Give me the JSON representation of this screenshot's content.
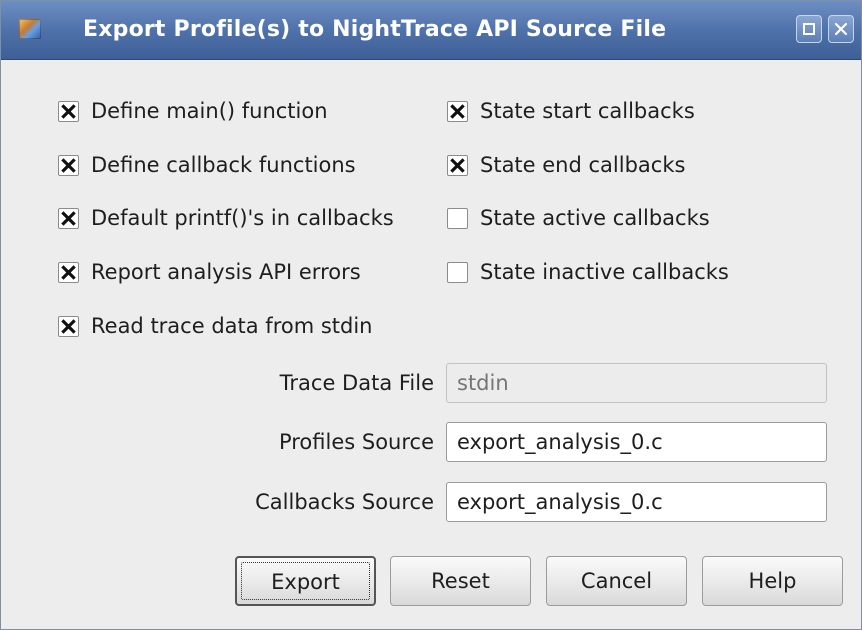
{
  "window": {
    "title": "Export Profile(s) to NightTrace API Source File",
    "icon": "nighttrace-app-icon",
    "controls": [
      "maximize-icon",
      "close-icon"
    ]
  },
  "options": {
    "left": [
      {
        "label": "Define main() function",
        "checked": true
      },
      {
        "label": "Define callback functions",
        "checked": true
      },
      {
        "label": "Default printf()'s in callbacks",
        "checked": true
      },
      {
        "label": "Report analysis API errors",
        "checked": true
      },
      {
        "label": "Read trace data from stdin",
        "checked": true
      }
    ],
    "right": [
      {
        "label": "State start callbacks",
        "checked": true
      },
      {
        "label": "State end callbacks",
        "checked": true
      },
      {
        "label": "State active callbacks",
        "checked": false
      },
      {
        "label": "State inactive callbacks",
        "checked": false
      }
    ]
  },
  "fields": {
    "trace_data_file": {
      "label": "Trace Data File",
      "placeholder": "stdin",
      "value": "",
      "disabled": true
    },
    "profiles_source": {
      "label": "Profiles Source",
      "value": "export_analysis_0.c",
      "disabled": false
    },
    "callbacks_source": {
      "label": "Callbacks Source",
      "value": "export_analysis_0.c",
      "disabled": false
    }
  },
  "buttons": {
    "export": "Export",
    "reset": "Reset",
    "cancel": "Cancel",
    "help": "Help"
  }
}
